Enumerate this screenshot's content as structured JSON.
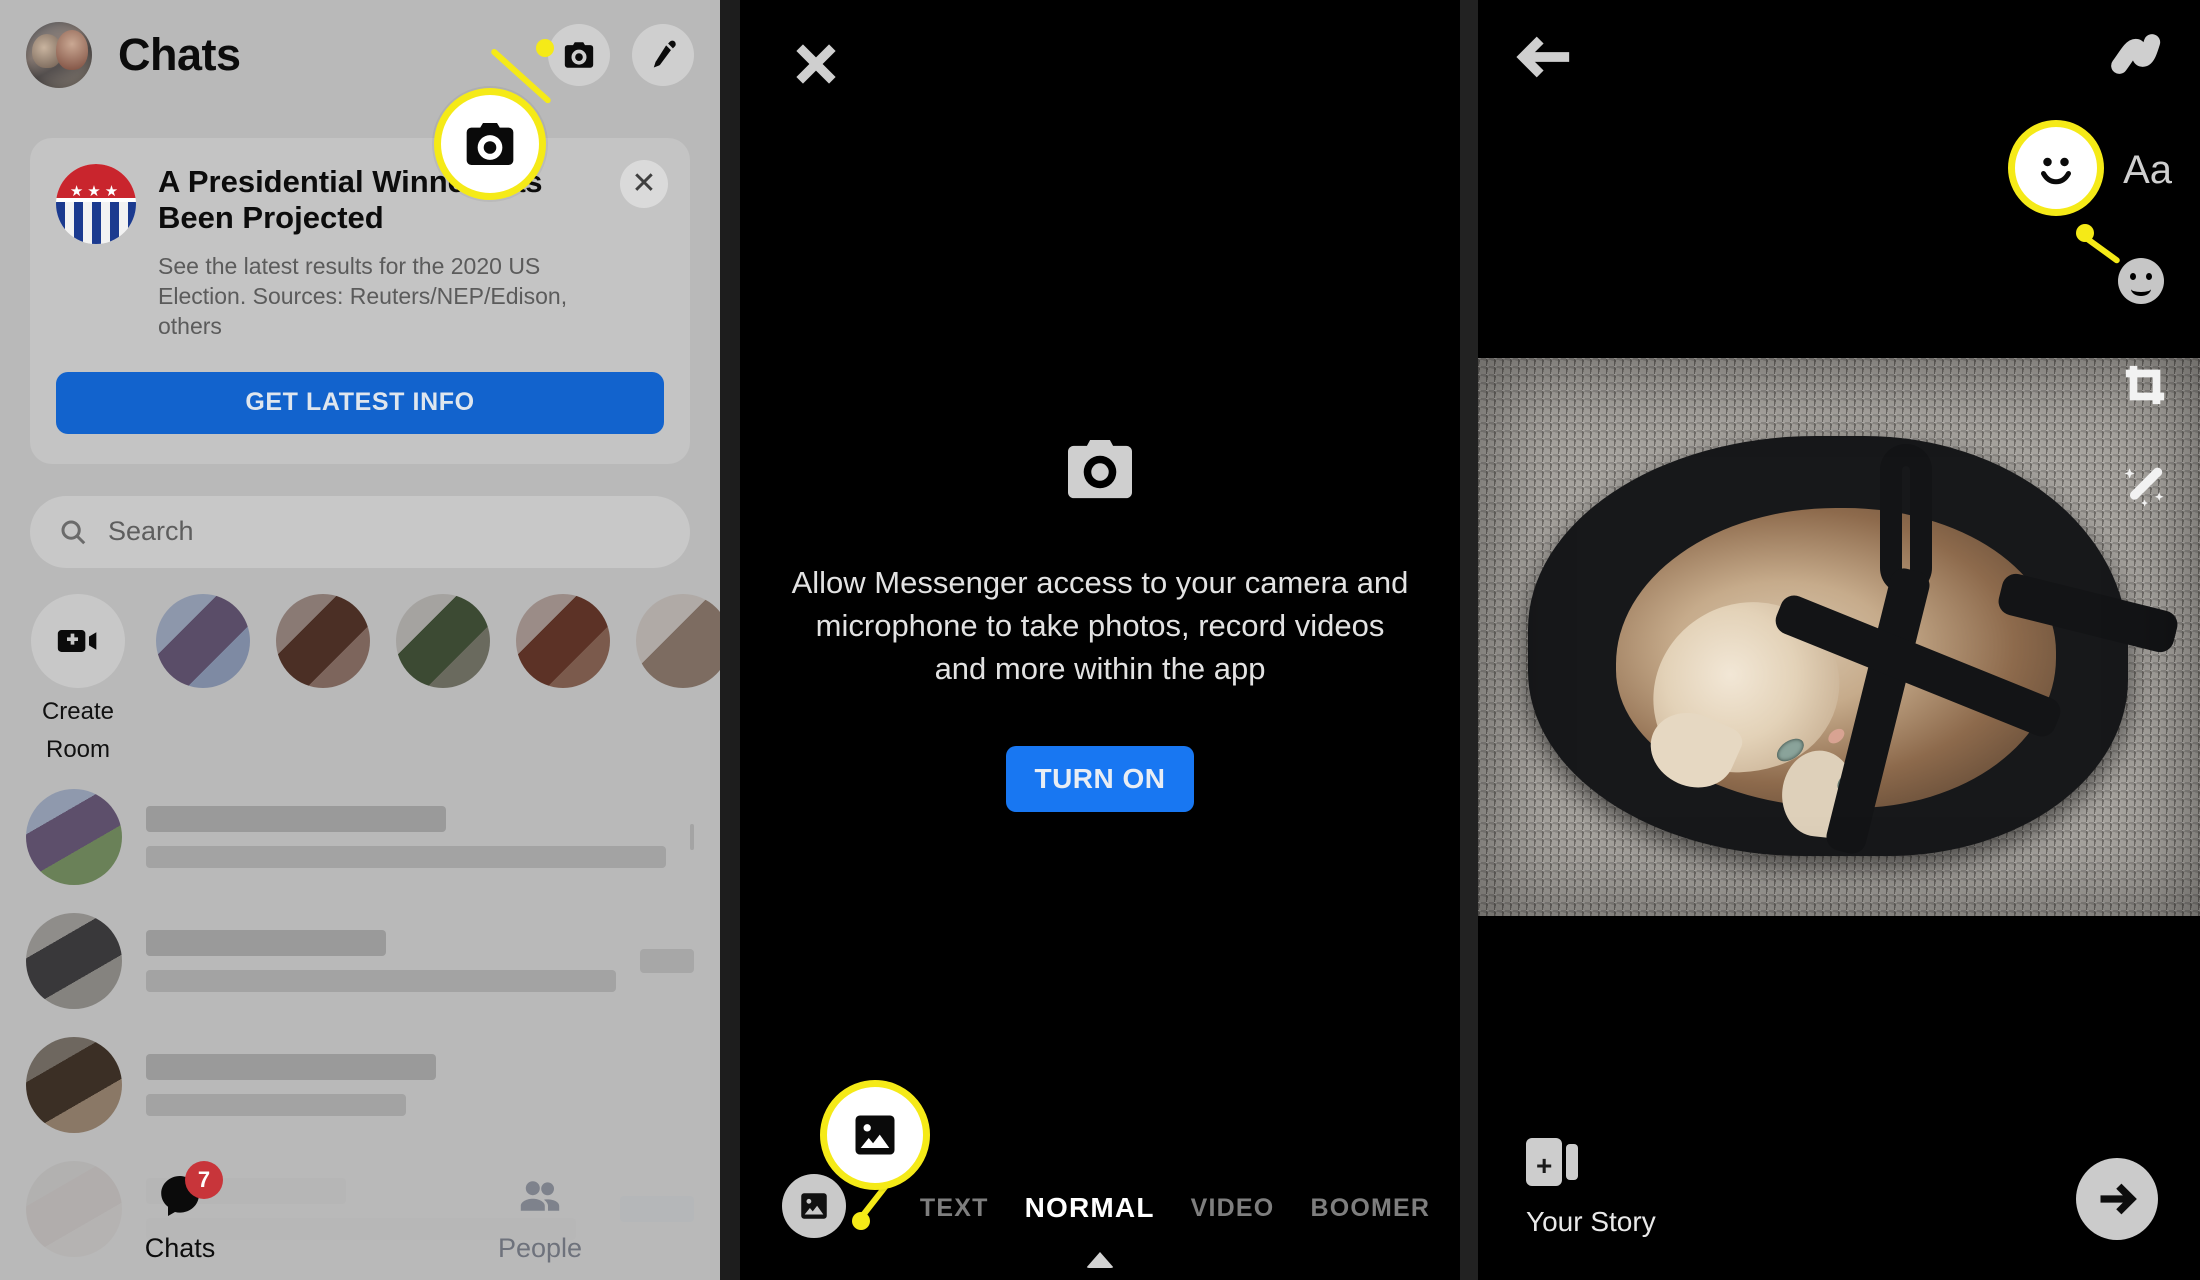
{
  "panel1": {
    "title": "Chats",
    "avatar_name": "user-avatar",
    "actions": [
      {
        "name": "camera-button",
        "icon": "camera-icon"
      },
      {
        "name": "compose-button",
        "icon": "pencil-icon"
      }
    ],
    "news_card": {
      "badge_icon": "election-badge-icon",
      "title": "A Presidential Winner Has Been Projected",
      "subtitle": "See the latest results for the 2020 US Election. Sources: Reuters/NEP/Edison, others",
      "cta_label": "GET LATEST INFO",
      "close_label": "✕",
      "cta_color": "#1263cd"
    },
    "search": {
      "placeholder": "Search",
      "icon": "search-icon"
    },
    "rooms": {
      "create_label": "Create\nRoom",
      "create_line1": "Create",
      "create_line2": "Room",
      "icon": "video-plus-icon"
    },
    "tabs": [
      {
        "name": "tab-chats",
        "label": "Chats",
        "icon": "chat-bubble-icon",
        "badge": "7",
        "active": true
      },
      {
        "name": "tab-people",
        "label": "People",
        "icon": "people-icon",
        "badge": "",
        "active": false
      }
    ],
    "badge_color": "#c8353a"
  },
  "panel2": {
    "close_icon": "close-icon",
    "camera_icon": "camera-icon",
    "permission_message": "Allow Messenger access to your camera and microphone to take photos, record videos and more within the app",
    "turn_on_label": "TURN ON",
    "turn_on_color": "#1877f2",
    "gallery_icon": "gallery-icon",
    "modes": [
      {
        "label": "TEXT",
        "active": false
      },
      {
        "label": "NORMAL",
        "active": true
      },
      {
        "label": "VIDEO",
        "active": false
      },
      {
        "label": "BOOMER",
        "active": false
      }
    ]
  },
  "panel3": {
    "back_icon": "arrow-left-icon",
    "doodle_icon": "doodle-draw-icon",
    "text_tool_label": "Aa",
    "sticker_icon": "smiley-sticker-icon",
    "crop_icon": "crop-icon",
    "magic_icon": "magic-wand-icon",
    "photo_alt": "cat-in-tote-bag-photo",
    "story_label": "Your Story",
    "story_icon": "add-to-story-icon",
    "send_icon": "arrow-right-icon"
  },
  "annotations": {
    "highlight_color": "#f5ea17",
    "items": [
      {
        "name": "callout-camera-button",
        "icon": "camera-icon"
      },
      {
        "name": "callout-sticker-button",
        "icon": "smiley-icon"
      },
      {
        "name": "callout-gallery-button",
        "icon": "gallery-icon"
      }
    ]
  }
}
